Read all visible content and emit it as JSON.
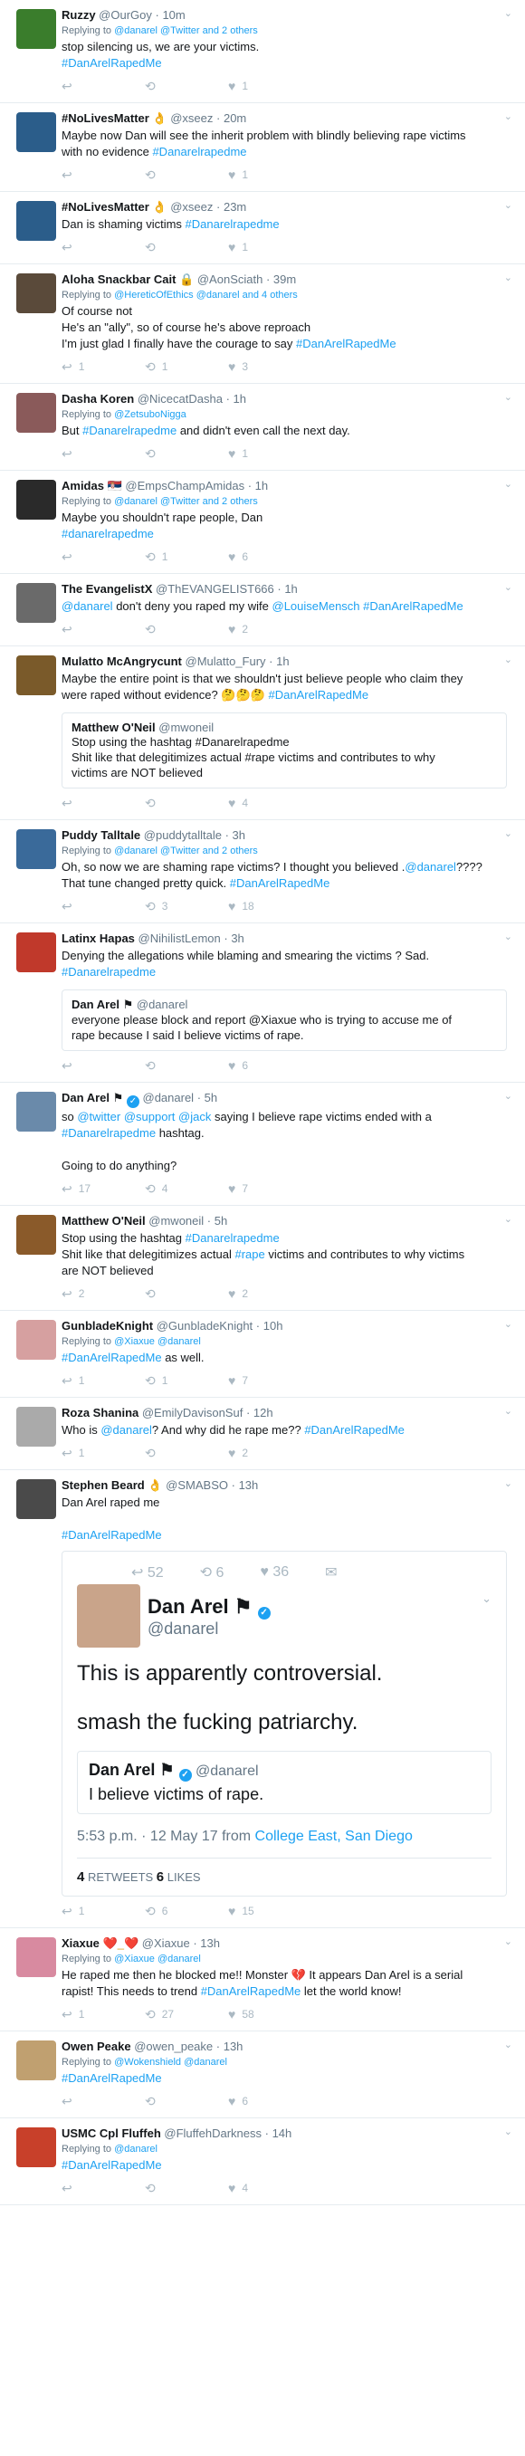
{
  "tweets": [
    {
      "name": "Ruzzy",
      "handle": "@OurGoy",
      "time": "10m",
      "reply": "Replying to",
      "reply_targets": "@danarel @Twitter and 2 others",
      "lines": [
        [
          "stop silencing us, we are your victims. ",
          ""
        ],
        [
          "#DanArelRapedMe",
          "h"
        ]
      ],
      "replies": "",
      "retweets": "",
      "likes": "1"
    },
    {
      "name": "#NoLivesMatter",
      "glyph": "👌",
      "handle": "@xseez",
      "time": "20m",
      "lines": [
        [
          "Maybe now Dan will see the inherit problem with blindly believing rape victims",
          ""
        ],
        [
          "with no evidence ",
          ""
        ]
      ],
      "hashtail": "#Danarelrapedme",
      "replies": "",
      "retweets": "",
      "likes": "1"
    },
    {
      "name": "#NoLivesMatter",
      "glyph": "👌",
      "handle": "@xseez",
      "time": "23m",
      "lines": [
        [
          "Dan is shaming victims ",
          ""
        ]
      ],
      "hashtail": "#Danarelrapedme",
      "replies": "",
      "retweets": "",
      "likes": "1"
    },
    {
      "name": "Aloha Snackbar Cait",
      "glyph": "🔒",
      "handle": "@AonSciath",
      "time": "39m",
      "reply": "Replying to",
      "reply_targets": "@HereticOfEthics @danarel and 4 others",
      "lines": [
        [
          "Of course not",
          ""
        ],
        [
          "He's an \"ally\", so of course he's above reproach",
          ""
        ],
        [
          "I'm just glad I finally have the courage to say ",
          ""
        ]
      ],
      "hashtail": "#DanArelRapedMe",
      "replies": "1",
      "retweets": "1",
      "likes": "3"
    },
    {
      "name": "Dasha Koren",
      "handle": "@NicecatDasha",
      "time": "1h",
      "reply": "Replying to",
      "reply_targets": "@ZetsuboNigga",
      "lines": [
        [
          "But ",
          ""
        ]
      ],
      "hashtail": "#Danarelrapedme",
      "tail_after": " and didn't even call the next day.",
      "replies": "",
      "retweets": "",
      "likes": "1"
    },
    {
      "name": "Amidas",
      "glyph": "🇷🇸",
      "handle": "@EmpsChampAmidas",
      "time": "1h",
      "reply": "Replying to",
      "reply_targets": "@danarel @Twitter and 2 others",
      "lines": [
        [
          "Maybe you shouldn't rape people, Dan",
          ""
        ]
      ],
      "hashtail_line": "#danarelrapedme",
      "replies": "",
      "retweets": "1",
      "likes": "6"
    },
    {
      "name": "The EvangelistX",
      "handle": "@ThEVANGELIST666",
      "time": "1h",
      "lines": [],
      "custom_text": {
        "a": "@danarel",
        "b": " don't deny you raped my wife ",
        "c": "@LouiseMensch",
        "d": " #DanArelRapedMe"
      },
      "replies": "",
      "retweets": "",
      "likes": "2"
    },
    {
      "name": "Mulatto McAngrycunt",
      "handle": "@Mulatto_Fury",
      "time": "1h",
      "lines": [
        [
          "Maybe the entire point is that we shouldn't just believe people who claim they",
          ""
        ],
        [
          "were raped without evidence? 🤔🤔🤔 ",
          ""
        ]
      ],
      "hashtail": "#DanArelRapedMe",
      "quote": {
        "name": "Matthew O'Neil",
        "handle": "@mwoneil",
        "lines": [
          "Stop using the hashtag #Danarelrapedme",
          "Shit like that delegitimizes actual #rape victims and contributes to why",
          "victims are NOT believed"
        ]
      },
      "replies": "",
      "retweets": "",
      "likes": "4"
    },
    {
      "name": "Puddy Talltale",
      "handle": "@puddytalltale",
      "time": "3h",
      "reply": "Replying to",
      "reply_targets": "@danarel @Twitter and 2 others",
      "custom_text": {
        "a": "Oh, so now we are shaming rape victims?  I thought you believed .",
        "b": "@danarel",
        "c": "????  That tune changed pretty quick. ",
        "d": "#DanArelRapedMe"
      },
      "replies": "",
      "retweets": "3",
      "likes": "18"
    },
    {
      "name": "Latinx Hapas",
      "handle": "@NihilistLemon",
      "time": "3h",
      "lines": [
        [
          "Denying the allegations while blaming and smearing the victims ?  Sad.",
          ""
        ]
      ],
      "hashtail_line": "#Danarelrapedme",
      "quote": {
        "name": "Dan Arel",
        "flag": "⚑",
        "handle": "@danarel",
        "lines": [
          "everyone please block and report @Xiaxue who is trying to accuse me of",
          "rape because I said I believe victims of rape."
        ]
      },
      "replies": "",
      "retweets": "",
      "likes": "6"
    },
    {
      "name": "Dan Arel",
      "flag": "⚑",
      "verified": "✓",
      "handle": "@danarel",
      "time": "5h",
      "custom_text": {
        "a": "so ",
        "b": "@twitter",
        "c": " ",
        "d": "@support",
        "e": " ",
        "f": "@jack",
        "g": " saying I believe rape victims ended with a"
      },
      "line2": [
        "#Danarelrapedme",
        " hashtag."
      ],
      "line3": "Going to do anything?",
      "replies": "17",
      "retweets": "4",
      "likes": "7"
    },
    {
      "name": "Matthew O'Neil",
      "handle": "@mwoneil",
      "time": "5h",
      "line_a": [
        "Stop using the hashtag ",
        "#Danarelrapedme"
      ],
      "line_b": [
        "Shit like that delegitimizes actual ",
        "#rape",
        " victims and contributes to why victims"
      ],
      "line_c": "are NOT believed",
      "replies": "2",
      "retweets": "",
      "likes": "2"
    },
    {
      "name": "GunbladeKnight",
      "handle": "@GunbladeKnight",
      "time": "10h",
      "reply": "Replying to",
      "reply_targets": "@Xiaxue @danarel",
      "hashtail_line": "#DanArelRapedMe",
      "tail_after": " as well.",
      "replies": "1",
      "retweets": "1",
      "likes": "7"
    },
    {
      "name": "Roza Shanina",
      "handle": "@EmilyDavisonSuf",
      "time": "12h",
      "line_a": [
        "Who is ",
        "@danarel",
        "? And why did he rape me?? ",
        "#DanArelRapedMe"
      ],
      "replies": "1",
      "retweets": "",
      "likes": "2"
    },
    {
      "name": "Stephen Beard",
      "glyph": "👌",
      "handle": "@SMABSO",
      "time": "13h",
      "lines": [
        [
          "Dan Arel raped me",
          ""
        ],
        [
          "",
          ""
        ]
      ],
      "hashtail_line": "#DanArelRapedMe",
      "embed": {
        "top_actions": {
          "replies": "52",
          "retweets": "6",
          "likes": "36"
        },
        "name": "Dan Arel",
        "flag": "⚑",
        "verified": "✓",
        "handle": "@danarel",
        "text": [
          "This is apparently controversial.",
          "smash the fucking patriarchy."
        ],
        "quote": {
          "name": "Dan Arel",
          "flag": "⚑",
          "verified": "✓",
          "handle": "@danarel",
          "text": "I believe victims of rape."
        },
        "time": "5:53 p.m. · 12 May 17",
        "from": "from",
        "location": "College East, San Diego",
        "retweets_n": "4",
        "retweets_l": "RETWEETS",
        "likes_n": "6",
        "likes_l": "LIKES"
      },
      "replies": "1",
      "retweets": "6",
      "likes": "15"
    },
    {
      "name": "Xiaxue",
      "glyph": "❤️_❤️",
      "handle": "@Xiaxue",
      "time": "13h",
      "reply": "Replying to",
      "reply_targets": "@Xiaxue @danarel",
      "line_a": [
        "He raped me then he blocked me!! Monster 💔 It appears Dan Arel is a serial",
        ""
      ],
      "line_b": [
        "rapist! This needs to trend ",
        "#DanArelRapedMe",
        " let the world know!"
      ],
      "replies": "1",
      "retweets": "27",
      "likes": "58"
    },
    {
      "name": "Owen Peake",
      "handle": "@owen_peake",
      "time": "13h",
      "reply": "Replying to",
      "reply_targets": "@Wokenshield @danarel",
      "hashtail_line": "#DanArelRapedMe",
      "replies": "",
      "retweets": "",
      "likes": "6"
    },
    {
      "name": "USMC Cpl Fluffeh",
      "handle": "@FluffehDarkness",
      "time": "14h",
      "reply": "Replying to",
      "reply_targets": "@danarel",
      "hashtail_line": "#DanArelRapedMe",
      "replies": "",
      "retweets": "",
      "likes": "4"
    }
  ],
  "ui": {
    "dot": "·",
    "caret": "⌄",
    "reply_icon": "↩",
    "retweet_icon": "⟲",
    "like_icon": "♥",
    "dm_icon": "✉"
  },
  "colors": {
    "link": "#1da1f2",
    "meta": "#657786",
    "icon": "#aab8c2",
    "border": "#e6ecf0"
  }
}
